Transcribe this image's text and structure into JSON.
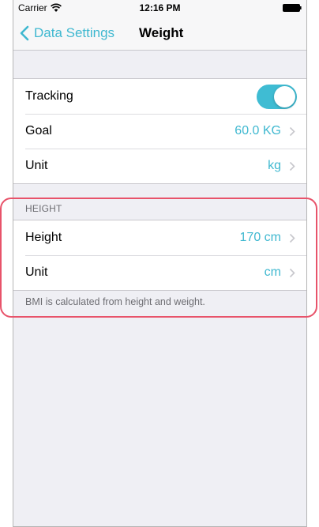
{
  "status_bar": {
    "carrier": "Carrier",
    "time": "12:16 PM",
    "wifi_icon": "wifi-icon",
    "battery_icon": "battery-icon"
  },
  "nav": {
    "back_label": "Data Settings",
    "title": "Weight"
  },
  "weight_group": {
    "rows": [
      {
        "label": "Tracking",
        "toggle_on": true
      },
      {
        "label": "Goal",
        "value": "60.0 KG"
      },
      {
        "label": "Unit",
        "value": "kg"
      }
    ]
  },
  "height_section": {
    "header": "HEIGHT",
    "rows": [
      {
        "label": "Height",
        "value": "170 cm"
      },
      {
        "label": "Unit",
        "value": "cm"
      }
    ],
    "footer": "BMI is calculated from height and weight."
  },
  "colors": {
    "accent": "#3fb8d0",
    "highlight": "#e8536a"
  }
}
